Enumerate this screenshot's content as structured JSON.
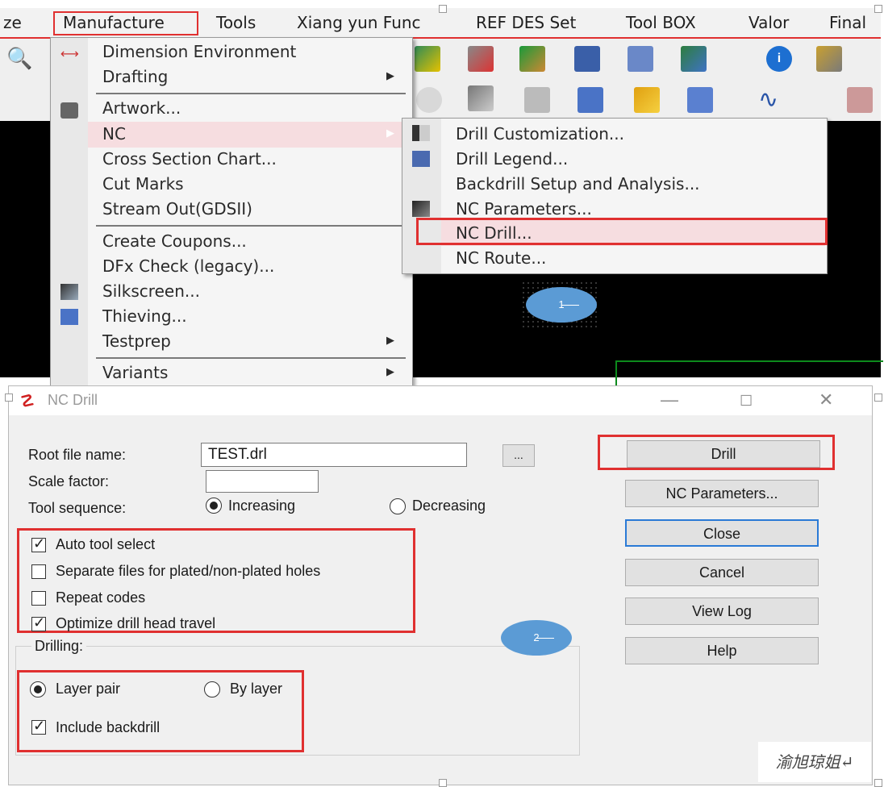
{
  "menubar": {
    "items": [
      "ze",
      "Manufacture",
      "Tools",
      "Xiang yun Func",
      "REF DES Set",
      "Tool BOX",
      "Valor",
      "Final"
    ]
  },
  "manufacture_menu": {
    "items": [
      {
        "label": "Dimension Environment",
        "submenu": false
      },
      {
        "label": "Drafting",
        "submenu": true
      },
      {
        "label": "Artwork...",
        "submenu": false
      },
      {
        "label": "NC",
        "submenu": true,
        "highlighted": true
      },
      {
        "label": "Cross Section Chart...",
        "submenu": false
      },
      {
        "label": "Cut Marks",
        "submenu": false
      },
      {
        "label": "Stream Out(GDSII)",
        "submenu": false
      },
      {
        "label": "Create Coupons...",
        "submenu": false
      },
      {
        "label": "DFx Check (legacy)...",
        "submenu": false
      },
      {
        "label": "Silkscreen...",
        "submenu": false
      },
      {
        "label": "Thieving...",
        "submenu": false
      },
      {
        "label": "Testprep",
        "submenu": true
      },
      {
        "label": "Variants",
        "submenu": true
      }
    ]
  },
  "nc_submenu": {
    "items": [
      "Drill Customization...",
      "Drill Legend...",
      "Backdrill Setup and Analysis...",
      "NC Parameters...",
      "NC Drill...",
      "NC Route..."
    ]
  },
  "annotations": {
    "step1": "1",
    "step2": "2"
  },
  "dialog": {
    "title": "NC Drill",
    "root_file_label": "Root file name:",
    "root_file_value": "TEST.drl",
    "browse_label": "...",
    "scale_label": "Scale factor:",
    "scale_value": "",
    "tool_seq_label": "Tool sequence:",
    "seq_increasing": "Increasing",
    "seq_decreasing": "Decreasing",
    "seq_selected": "Increasing",
    "options": [
      {
        "label": "Auto tool select",
        "checked": true
      },
      {
        "label": "Separate files for plated/non-plated holes",
        "checked": false
      },
      {
        "label": "Repeat codes",
        "checked": false
      },
      {
        "label": "Optimize drill head travel",
        "checked": true
      }
    ],
    "drilling_group": "Drilling:",
    "drill_layer_pair": "Layer pair",
    "drill_by_layer": "By layer",
    "drill_selected": "Layer pair",
    "include_backdrill": {
      "label": "Include backdrill",
      "checked": true
    },
    "buttons": {
      "drill": "Drill",
      "nc_parameters": "NC Parameters...",
      "close": "Close",
      "cancel": "Cancel",
      "view_log": "View Log",
      "help": "Help"
    }
  },
  "watermark": "渝旭琼姐↵",
  "colors": {
    "highlight_red": "#e03030",
    "menu_hover": "#f6dde0",
    "annotation_blue": "#5b9bd5",
    "canvas": "#000000"
  }
}
